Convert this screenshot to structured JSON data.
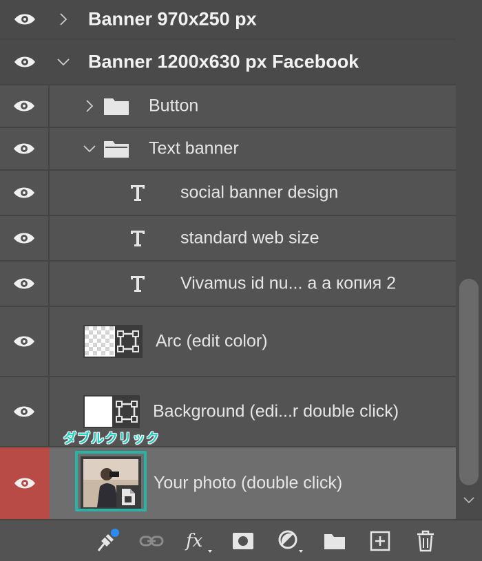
{
  "layers": [
    {
      "name": "Banner 970x250 px",
      "kind": "artboard",
      "expanded": false
    },
    {
      "name": "Banner 1200x630 px Facebook",
      "kind": "artboard",
      "expanded": true
    },
    {
      "name": "Button",
      "kind": "group",
      "expanded": false
    },
    {
      "name": "Text banner",
      "kind": "group",
      "expanded": true
    },
    {
      "name": "social banner design",
      "kind": "text"
    },
    {
      "name": "standard web size",
      "kind": "text"
    },
    {
      "name": "Vivamus id nu... a a копия 2",
      "kind": "text"
    },
    {
      "name": "Arc (edit color)",
      "kind": "smart-object"
    },
    {
      "name": "Background (edi...r double click)",
      "kind": "smart-object"
    },
    {
      "name": "Your photo (double click)",
      "kind": "smart-object",
      "selected": true
    }
  ],
  "annotation": {
    "text": "ダブルクリック"
  },
  "footer_tools": [
    "pin-icon",
    "link-icon",
    "fx-icon",
    "mask-icon",
    "adjustment-icon",
    "folder-icon",
    "new-layer-icon",
    "trash-icon"
  ],
  "colors": {
    "panel_bg": "#535353",
    "selected_row": "#6e6e6e",
    "selected_eye": "#b94b47",
    "annotation": "#1ecfbf",
    "highlight": "#29b3a6",
    "badge": "#2a8bf2"
  }
}
